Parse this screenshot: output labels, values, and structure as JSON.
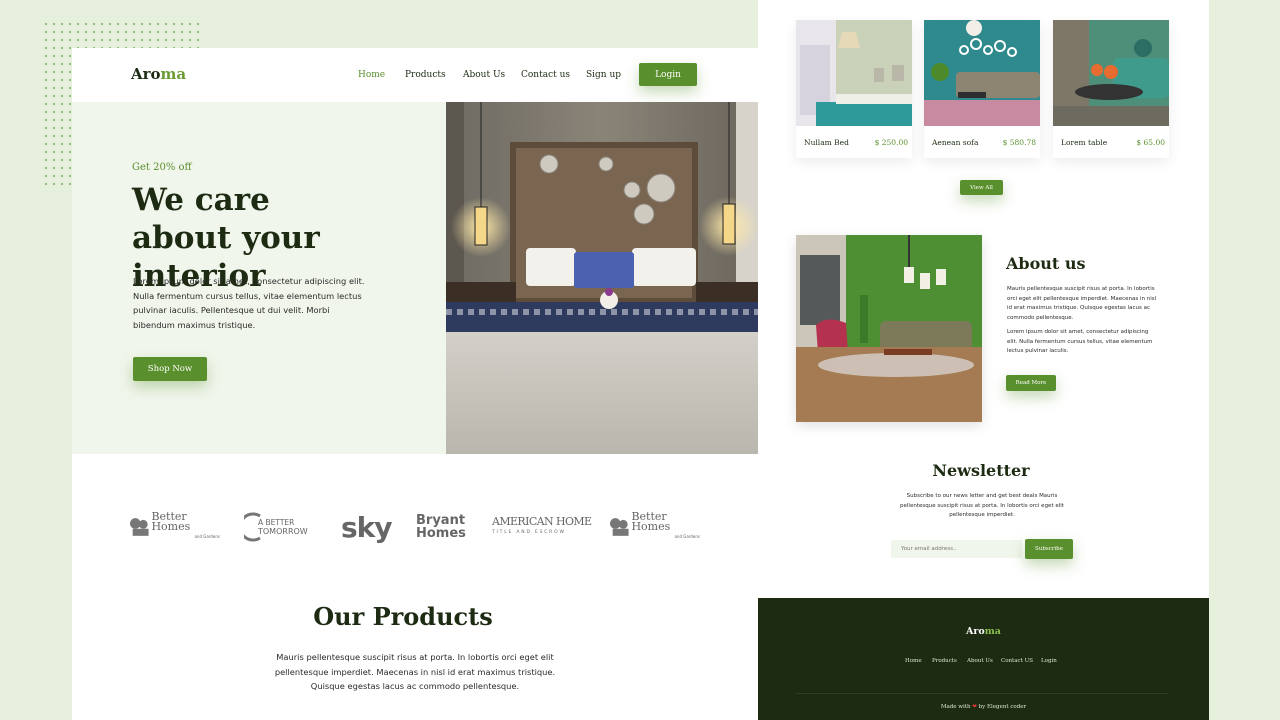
{
  "left": {
    "logo": {
      "part1": "Aro",
      "part2": "ma"
    },
    "nav": [
      "Home",
      "Products",
      "About Us",
      "Contact us",
      "Sign up"
    ],
    "login_label": "Login",
    "hero": {
      "promo": "Get 20% off",
      "title_line1": "We care",
      "title_line2": "about your interior",
      "text": "Lorem ipsum dolor sit amet, consectetur adipiscing elit. Nulla fermentum cursus tellus, vitae elementum lectus pulvinar iaculis. Pellentesque ut dui velit. Morbi bibendum maximus tristique.",
      "cta": "Shop Now"
    },
    "brands": [
      {
        "name": "Better Homes",
        "sub": "and Gardens"
      },
      {
        "name": "A BETTER",
        "sub": "TOMORROW"
      },
      {
        "name": "sky"
      },
      {
        "name": "Bryant",
        "sub": "Homes"
      },
      {
        "name": "AMERICAN HOME",
        "sub": "TITLE AND ESCROW"
      },
      {
        "name": "Better Homes",
        "sub": "and Gardens"
      }
    ],
    "products": {
      "title": "Our Products",
      "text": "Mauris pellentesque suscipit risus at porta. In lobortis orci eget elit pellentesque imperdiet. Maecenas in nisl id erat maximus tristique. Quisque egestas lacus ac commodo pellentesque."
    }
  },
  "right": {
    "cards": [
      {
        "name": "Nullam Bed",
        "price": "$ 250.00"
      },
      {
        "name": "Aenean sofa",
        "price": "$ 580.78"
      },
      {
        "name": "Lorem table",
        "price": "$ 65.00"
      }
    ],
    "view_all": "View All",
    "about": {
      "title": "About us",
      "p1": "Mauris pellentesque suscipit risus at porta. In lobortis orci eget elit pellentesque imperdiet. Maecenas in nisl id erat maximus tristique. Quisque egestas lacus ac commodo pellentesque.",
      "p2": "Lorem ipsum dolor sit amet, consectetur adipiscing elit. Nulla fermentum cursus tellus, vitae elementum lectus pulvinar iaculis.",
      "read_more": "Read More"
    },
    "newsletter": {
      "title": "Newsletter",
      "text": "Subscribe to our news letter and get best deals Mauris pellentesque suscipit risus at porta. In lobortis orci eget elit pellentesque imperdiet.",
      "placeholder": "Your email address..",
      "subscribe": "Subscribe"
    },
    "footer": {
      "logo": {
        "part1": "Aro",
        "part2": "ma"
      },
      "links": [
        "Home",
        "Products",
        "About Us",
        "Contact US",
        "Login"
      ],
      "made_with": "Made with",
      "by": "by",
      "author": "Elegent coder"
    }
  },
  "colors": {
    "accent": "#5a8f2d",
    "footer": "#1d2b12",
    "hero_bg": "#f1f6ec",
    "page_bg": "#e6f0dc"
  }
}
